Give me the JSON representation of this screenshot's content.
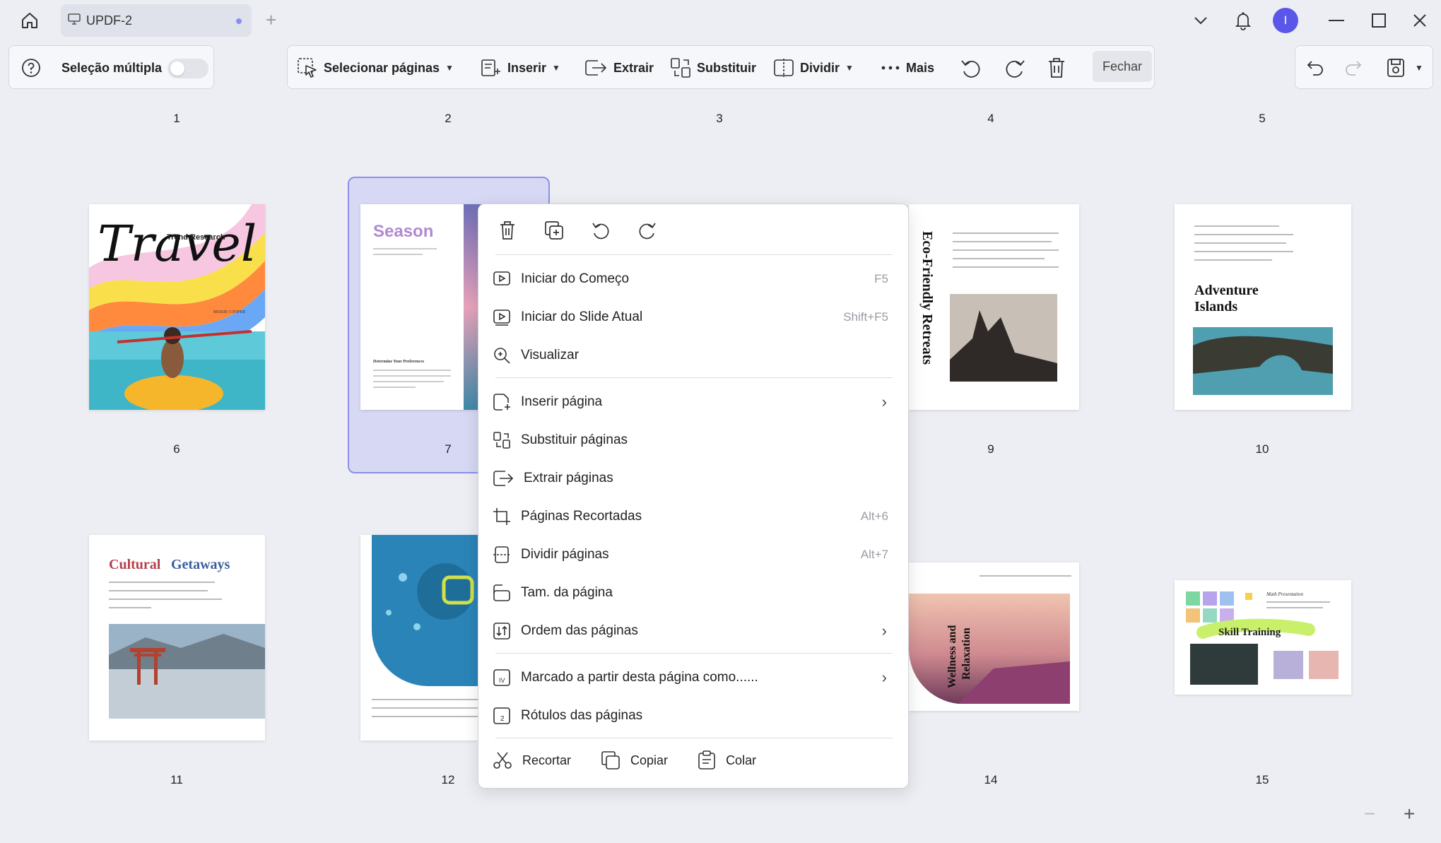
{
  "titlebar": {
    "tab_label": "UPDF-2",
    "avatar_initial": "I"
  },
  "toolbar": {
    "multi_select_label": "Seleção múltipla",
    "select_pages": "Selecionar páginas",
    "insert": "Inserir",
    "extract": "Extrair",
    "replace": "Substituir",
    "split": "Dividir",
    "more": "Mais",
    "close": "Fechar"
  },
  "pages": {
    "numbers_row1": [
      "1",
      "2",
      "3",
      "4",
      "5"
    ],
    "numbers_row2": [
      "6",
      "7",
      "9",
      "10"
    ],
    "numbers_row3": [
      "11",
      "12",
      "14",
      "15"
    ],
    "p6_title": "Travel",
    "p6_sub": "Trend Research",
    "p6_author": "BESSIE COOPER",
    "p7_title": "Season",
    "p7_heading": "Determine Your Preferences",
    "p9_title": "Eco-Friendly Retreats",
    "p10_title_1": "Adventure",
    "p10_title_2": "Islands",
    "p11_title_a": "Cultural",
    "p11_title_b": "Getaways",
    "p14_title_1": "Wellness and",
    "p14_title_2": "Relaxation",
    "p15_title": "Skill Training",
    "p15_sub": "Math Presentation"
  },
  "context_menu": {
    "items": [
      {
        "label": "Iniciar do Começo",
        "shortcut": "F5"
      },
      {
        "label": "Iniciar do Slide Atual",
        "shortcut": "Shift+F5"
      },
      {
        "label": "Visualizar",
        "shortcut": ""
      },
      {
        "label": "Inserir página",
        "shortcut": ""
      },
      {
        "label": "Substituir páginas",
        "shortcut": ""
      },
      {
        "label": "Extrair páginas",
        "shortcut": ""
      },
      {
        "label": "Páginas Recortadas",
        "shortcut": "Alt+6"
      },
      {
        "label": "Dividir páginas",
        "shortcut": "Alt+7"
      },
      {
        "label": "Tam. da página",
        "shortcut": ""
      },
      {
        "label": "Ordem das páginas",
        "shortcut": ""
      },
      {
        "label": "Marcado a partir desta página como......",
        "shortcut": ""
      },
      {
        "label": "Rótulos das páginas",
        "shortcut": ""
      }
    ],
    "cut": "Recortar",
    "copy": "Copiar",
    "paste": "Colar"
  },
  "icons": {
    "titlebar": [
      "home-icon",
      "monitor-icon",
      "plus-icon",
      "chevron-down-icon",
      "bell-icon",
      "minimize-icon",
      "maximize-icon",
      "close-icon"
    ],
    "toolbar": [
      "help-icon",
      "cursor-select-icon",
      "insert-icon",
      "extract-icon",
      "replace-icon",
      "split-icon",
      "more-icon",
      "rotate-left-icon",
      "rotate-right-icon",
      "trash-icon",
      "undo-icon",
      "redo-icon",
      "save-icon"
    ]
  },
  "colors": {
    "accent": "#5a56e8",
    "selection": "#d6d8f4"
  }
}
